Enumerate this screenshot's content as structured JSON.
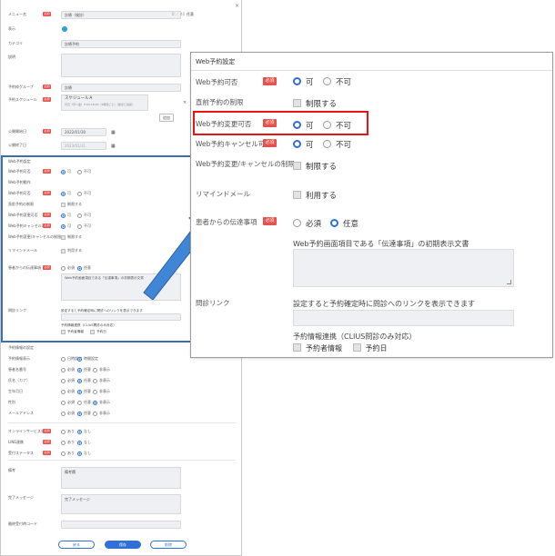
{
  "req_badge": "必須",
  "bg_form": {
    "menu_name": {
      "label": "メニュー名",
      "value": "診療（検診）",
      "suffix": "0 ／ 40",
      "tail": "任意"
    },
    "display": {
      "label": "表示"
    },
    "category": {
      "label": "カテゴリ",
      "value": "診療予約"
    },
    "description": {
      "label": "説明"
    },
    "reservation_group": {
      "label": "予約枠グループ",
      "value": "診療"
    },
    "schedule": {
      "label": "予約スケジュール",
      "value": "スケジュールＡ",
      "sub": "平日（月〜金）9:00-18:00（2時間ごと）（後ほど追加）",
      "add": "追加"
    },
    "start_date": {
      "label": "公開開始日",
      "value": "2022/01/30"
    },
    "end_date": {
      "label": "公開終了日",
      "value": "2023/01/31"
    },
    "web_section": "Web予約設定",
    "web_rows": [
      {
        "label": "Web予約可否",
        "req": true,
        "type": "radio",
        "a": "可",
        "b": "不可",
        "sel": "a"
      },
      {
        "label": "Web予約動作",
        "req": false,
        "type": "none"
      },
      {
        "label": "Web予約可否",
        "req": true,
        "type": "radio",
        "a": "可",
        "b": "不可",
        "sel": "a"
      },
      {
        "label": "直前予約の制限",
        "req": false,
        "type": "check",
        "a": "制限する"
      },
      {
        "label": "Web予約変更可否",
        "req": true,
        "type": "radio",
        "a": "可",
        "b": "不可",
        "sel": "a"
      },
      {
        "label": "Web予約キャンセル可否",
        "req": true,
        "type": "radio",
        "a": "可",
        "b": "不可",
        "sel": "a"
      },
      {
        "label": "Web予約変更/キャンセルの制限",
        "req": false,
        "type": "check",
        "a": "制限する"
      },
      {
        "label": "リマインドメール",
        "req": false,
        "type": "check",
        "a": "利用する"
      },
      {
        "label": "患者からの伝達事項",
        "req": true,
        "type": "radio",
        "a": "必須",
        "b": "任意",
        "sel": "b"
      }
    ],
    "note_text": "Web予約画面項目である「伝達事項」の初期表示文書",
    "link_label": "問診リンク",
    "link_text": "設定すると予約確定時に問診へのリンクを表示できます",
    "link_sub": "予約情報連携（CLIUS問診のみ対応）",
    "link_opt_a": "予約者情報",
    "link_opt_b": "予約日",
    "lower_section": "予約情報の設定",
    "lower_rows": [
      {
        "label": "予約情報表示",
        "type": "radio",
        "a": "日時設定",
        "b": "時間設定",
        "c": "",
        "sel": "b"
      },
      {
        "label": "患者名番号",
        "type": "radio",
        "a": "必須",
        "b": "任意",
        "c": "非表示",
        "sel": "b"
      },
      {
        "label": "氏名（カナ）",
        "type": "radio",
        "a": "必須",
        "b": "任意",
        "c": "非表示",
        "sel": "b"
      },
      {
        "label": "生年月日",
        "type": "radio",
        "a": "必須",
        "b": "任意",
        "c": "非表示",
        "sel": "b"
      },
      {
        "label": "性別",
        "type": "radio",
        "a": "必須",
        "b": "任意",
        "c": "非表示",
        "sel": "c"
      },
      {
        "label": "メールアドレス",
        "type": "radio",
        "a": "必須",
        "b": "任意",
        "c": "非表示",
        "sel": "b"
      }
    ],
    "yn_rows": [
      {
        "label": "オンラインサービス対応",
        "a": "あり",
        "b": "なし",
        "sel": "b"
      },
      {
        "label": "LINE連携",
        "a": "あり",
        "b": "なし",
        "sel": "b"
      },
      {
        "label": "受付ステータス",
        "a": "あり",
        "b": "なし",
        "sel": "b"
      }
    ],
    "remarks_label": "備考",
    "remarks_value": "備考欄",
    "complete_label": "完了メッセージ",
    "complete_value": "完了メッセージ",
    "code_label": "最終受付時コード",
    "buttons": {
      "back": "戻る",
      "save": "保存",
      "delete": "削除"
    }
  },
  "zoom": {
    "title": "Web予約設定",
    "rows": {
      "web_ok": {
        "label": "Web予約可否",
        "a": "可",
        "b": "不可"
      },
      "limit": {
        "label": "直前予約の制限",
        "a": "制限する"
      },
      "change": {
        "label": "Web予約変更可否",
        "a": "可",
        "b": "不可"
      },
      "cancel": {
        "label": "Web予約キャンセル可否",
        "a": "可",
        "b": "不可"
      },
      "change_cancel_limit": {
        "label": "Web予約変更/キャンセルの制限",
        "a": "制限する"
      },
      "remind": {
        "label": "リマインドメール",
        "a": "利用する"
      },
      "message": {
        "label": "患者からの伝達事項",
        "a": "必須",
        "b": "任意"
      }
    },
    "note_text": "Web予約画面項目である「伝達事項」の初期表示文書",
    "link_label": "問診リンク",
    "link_text": "設定すると予約確定時に問診へのリンクを表示できます",
    "link_sub": "予約情報連携（CLIUS問診のみ対応）",
    "link_opt_a": "予約者情報",
    "link_opt_b": "予約日"
  }
}
